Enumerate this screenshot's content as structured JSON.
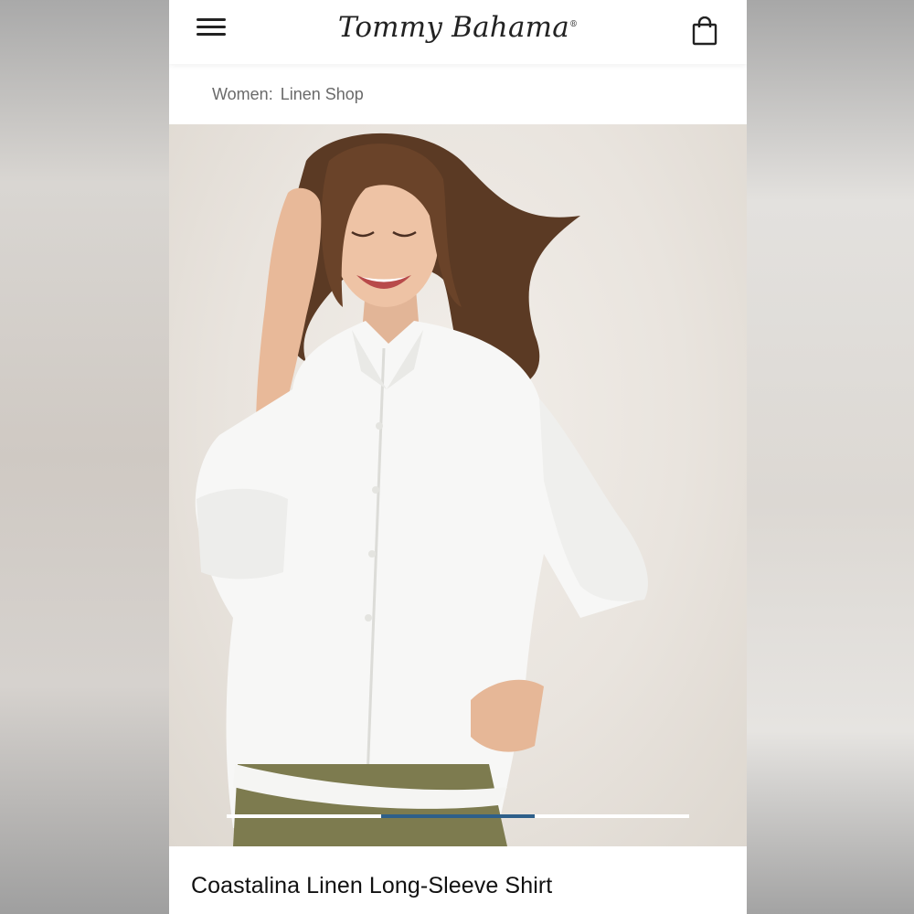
{
  "header": {
    "brand": "Tommy Bahama",
    "brand_mark": "®",
    "menu_icon": "hamburger-menu-icon",
    "cart_icon": "shopping-bag-icon"
  },
  "breadcrumb": {
    "items": [
      "Women:",
      "Linen Shop"
    ]
  },
  "product": {
    "title": "Coastalina Linen Long-Sleeve Shirt",
    "image_alt": "Woman smiling wearing a white linen long-sleeve shirt and olive pants"
  },
  "carousel": {
    "total": 3,
    "active_index": 1,
    "active_color": "#2e5f8a"
  }
}
